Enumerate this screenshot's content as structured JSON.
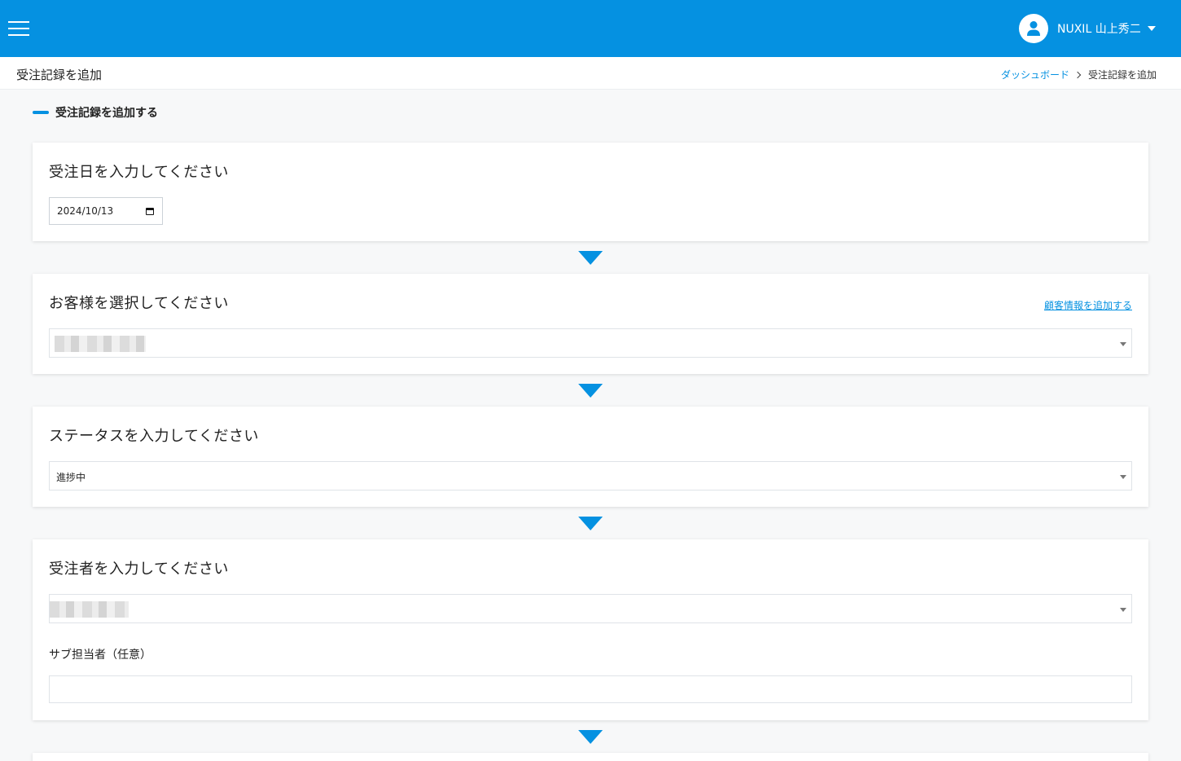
{
  "header": {
    "user_name": "NUXIL 山上秀二",
    "menu_icon": "hamburger-menu-icon",
    "avatar_icon": "user-avatar-icon",
    "dropdown_icon": "caret-down-icon",
    "brand_color": "#0591e1"
  },
  "subheader": {
    "page_title": "受注記録を追加",
    "breadcrumb": {
      "dashboard": "ダッシュボード",
      "current": "受注記録を追加"
    }
  },
  "section": {
    "title": "受注記録を追加する"
  },
  "order_date": {
    "title": "受注日を入力してください",
    "value": "2024/10/13"
  },
  "customer": {
    "title": "お客様を選択してください",
    "add_link": "顧客情報を追加する"
  },
  "status": {
    "title": "ステータスを入力してください",
    "value": "進捗中"
  },
  "assignee": {
    "title": "受注者を入力してください",
    "sub_label": "サブ担当者（任意）",
    "sub_value": ""
  }
}
